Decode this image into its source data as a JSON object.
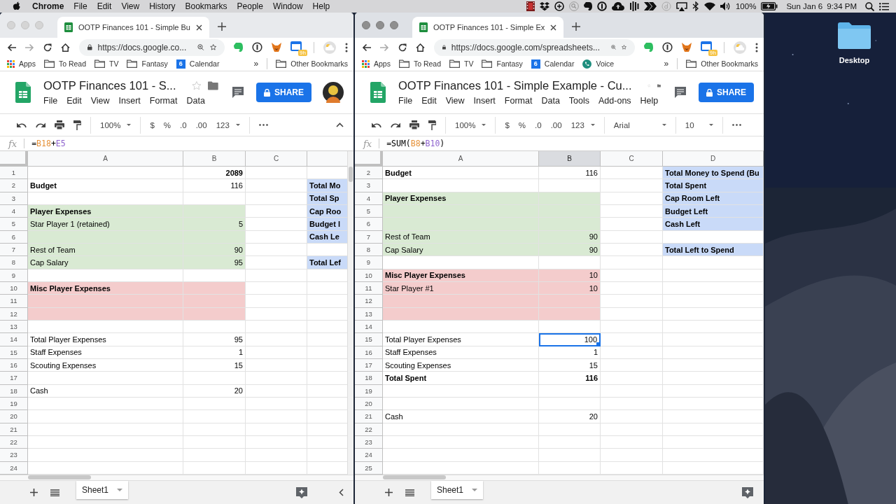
{
  "menubar": {
    "app": "Chrome",
    "menus": [
      "File",
      "Edit",
      "View",
      "History",
      "Bookmarks",
      "People",
      "Window",
      "Help"
    ],
    "battery": "100%",
    "date": "Sun Jan 6",
    "time": "9:34 PM"
  },
  "windows": [
    {
      "active": false,
      "tab_title": "OOTP Finances 101 - Simple Bu",
      "url": "https://docs.google.co...",
      "extension_badge": "9h",
      "bookmarks": [
        {
          "kind": "apps",
          "label": "Apps"
        },
        {
          "kind": "folder",
          "label": "To Read"
        },
        {
          "kind": "folder",
          "label": "TV"
        },
        {
          "kind": "folder",
          "label": "Fantasy"
        },
        {
          "kind": "calendar",
          "label": "Calendar",
          "icon_text": "6"
        }
      ],
      "more_bookmarks": "»",
      "other_bookmarks": "Other Bookmarks",
      "doc_title": "OOTP Finances 101 - S...",
      "menus": [
        "File",
        "Edit",
        "View",
        "Insert",
        "Format",
        "Data"
      ],
      "share": "SHARE",
      "show_avatar": true,
      "zoom": "100%",
      "format_items": [
        "$",
        "%",
        ".0",
        ".00"
      ],
      "number_format": "123",
      "show_collapse": true,
      "formula": {
        "color": "#000000",
        "parts": [
          {
            "text": "="
          },
          {
            "text": "B18",
            "color": "#e69138"
          },
          {
            "text": "+"
          },
          {
            "text": "E5",
            "color": "#8e63ce"
          }
        ]
      },
      "function_label": "fx",
      "columns": [
        {
          "label": "A",
          "selected": false
        },
        {
          "label": "B",
          "selected": false
        },
        {
          "label": "C",
          "selected": false
        },
        {}
      ],
      "rows": [
        {
          "num": "1",
          "cells": [
            {},
            {
              "text": "2089",
              "bold": true
            },
            {},
            {}
          ]
        },
        {
          "num": "2",
          "cells": [
            {
              "text": "Budget",
              "bold": true
            },
            {
              "text": "116"
            },
            {},
            {
              "text": "Total Mo",
              "bold": true,
              "color": "#c9daf8"
            }
          ]
        },
        {
          "num": "3",
          "cells": [
            {},
            {},
            {},
            {
              "text": "Total Sp",
              "bold": true,
              "color": "#c9daf8"
            }
          ]
        },
        {
          "num": "4",
          "cells": [
            {
              "text": "Player Expenses",
              "bold": true,
              "color": "#d9ead3"
            },
            {
              "color": "#d9ead3"
            },
            {},
            {
              "text": "Cap Roo",
              "bold": true,
              "color": "#c9daf8"
            }
          ]
        },
        {
          "num": "5",
          "cells": [
            {
              "text": "Star Player 1 (retained)",
              "color": "#d9ead3"
            },
            {
              "text": "5",
              "color": "#d9ead3"
            },
            {},
            {
              "text": "Budget l",
              "bold": true,
              "color": "#c9daf8"
            }
          ]
        },
        {
          "num": "6",
          "cells": [
            {
              "color": "#d9ead3"
            },
            {
              "color": "#d9ead3"
            },
            {},
            {
              "text": "Cash Le",
              "bold": true,
              "color": "#c9daf8"
            }
          ]
        },
        {
          "num": "7",
          "cells": [
            {
              "text": "Rest of Team",
              "color": "#d9ead3"
            },
            {
              "text": "90",
              "color": "#d9ead3"
            },
            {},
            {}
          ]
        },
        {
          "num": "8",
          "cells": [
            {
              "text": "Cap Salary",
              "color": "#d9ead3"
            },
            {
              "text": "95",
              "color": "#d9ead3"
            },
            {},
            {
              "text": "Total Lef",
              "bold": true,
              "color": "#c9daf8"
            }
          ]
        },
        {
          "num": "9"
        },
        {
          "num": "10",
          "cells": [
            {
              "text": "Misc Player Expenses",
              "bold": true,
              "color": "#f4cccc"
            },
            {
              "color": "#f4cccc"
            },
            {},
            {}
          ]
        },
        {
          "num": "11",
          "cells": [
            {
              "color": "#f4cccc"
            },
            {
              "color": "#f4cccc"
            },
            {},
            {}
          ]
        },
        {
          "num": "12",
          "cells": [
            {
              "color": "#f4cccc"
            },
            {
              "color": "#f4cccc"
            },
            {},
            {}
          ]
        },
        {
          "num": "13"
        },
        {
          "num": "14",
          "cells": [
            {
              "text": "Total Player Expenses"
            },
            {
              "text": "95"
            },
            {},
            {}
          ]
        },
        {
          "num": "15",
          "cells": [
            {
              "text": "Staff Expenses"
            },
            {
              "text": "1"
            },
            {},
            {}
          ]
        },
        {
          "num": "16",
          "cells": [
            {
              "text": "Scouting Expenses"
            },
            {
              "text": "15"
            },
            {},
            {}
          ]
        },
        {
          "num": "17"
        },
        {
          "num": "18",
          "cells": [
            {
              "text": "Cash"
            },
            {
              "text": "20"
            },
            {},
            {}
          ]
        },
        {
          "num": "19"
        },
        {
          "num": "20"
        },
        {
          "num": "21"
        },
        {
          "num": "22"
        },
        {
          "num": "23"
        },
        {
          "num": "24"
        }
      ],
      "sheet_tab": "Sheet1",
      "show_side_toggle": true
    },
    {
      "active": true,
      "tab_title": "OOTP Finances 101 - Simple Ex",
      "url": "https://docs.google.com/spreadsheets...",
      "extension_badge": "9h",
      "bookmarks": [
        {
          "kind": "apps",
          "label": "Apps"
        },
        {
          "kind": "folder",
          "label": "To Read"
        },
        {
          "kind": "folder",
          "label": "TV"
        },
        {
          "kind": "folder",
          "label": "Fantasy"
        },
        {
          "kind": "calendar",
          "label": "Calendar",
          "icon_text": "6"
        },
        {
          "kind": "voice",
          "label": "Voice"
        }
      ],
      "more_bookmarks": "»",
      "other_bookmarks": "Other Bookmarks",
      "doc_title": "OOTP Finances 101 - Simple Example - Cu...",
      "menus": [
        "File",
        "Edit",
        "View",
        "Insert",
        "Format",
        "Data",
        "Tools",
        "Add-ons",
        "Help"
      ],
      "share": "SHARE",
      "zoom": "100%",
      "format_items": [
        "$",
        "%",
        ".0",
        ".00"
      ],
      "number_format": "123",
      "font": "Arial",
      "font_size": "10",
      "formula": {
        "color": "#000000",
        "parts": [
          {
            "text": "=SUM("
          },
          {
            "text": "B8",
            "color": "#e69138"
          },
          {
            "text": "+"
          },
          {
            "text": "B10",
            "color": "#8e63ce"
          },
          {
            "text": ")"
          }
        ]
      },
      "function_label": "fx",
      "columns": [
        {
          "label": "A",
          "selected": false
        },
        {
          "label": "B",
          "selected": true
        },
        {
          "label": "C",
          "selected": false
        },
        {
          "label": "D",
          "selected": false
        }
      ],
      "rows": [
        {
          "num": "2",
          "cells": [
            {
              "text": "Budget",
              "bold": true
            },
            {
              "text": "116"
            },
            {},
            {
              "text": "Total Money to Spend (Bu",
              "bold": true,
              "color": "#c9daf8"
            }
          ]
        },
        {
          "num": "3",
          "cells": [
            {},
            {},
            {},
            {
              "text": "Total Spent",
              "bold": true,
              "color": "#c9daf8"
            }
          ]
        },
        {
          "num": "4",
          "cells": [
            {
              "text": "Player Expenses",
              "bold": true,
              "color": "#d9ead3"
            },
            {
              "color": "#d9ead3"
            },
            {},
            {
              "text": "Cap Room Left",
              "bold": true,
              "color": "#c9daf8"
            }
          ]
        },
        {
          "num": "5",
          "cells": [
            {
              "color": "#d9ead3"
            },
            {
              "color": "#d9ead3"
            },
            {},
            {
              "text": "Budget Left",
              "bold": true,
              "color": "#c9daf8"
            }
          ]
        },
        {
          "num": "6",
          "cells": [
            {
              "color": "#d9ead3"
            },
            {
              "color": "#d9ead3"
            },
            {},
            {
              "text": "Cash Left",
              "bold": true,
              "color": "#c9daf8"
            }
          ]
        },
        {
          "num": "7",
          "cells": [
            {
              "text": "Rest of Team",
              "color": "#d9ead3"
            },
            {
              "text": "90",
              "color": "#d9ead3"
            },
            {},
            {}
          ]
        },
        {
          "num": "8",
          "cells": [
            {
              "text": "Cap Salary",
              "color": "#d9ead3"
            },
            {
              "text": "90",
              "color": "#d9ead3"
            },
            {},
            {
              "text": "Total Left to Spend",
              "bold": true,
              "color": "#c9daf8"
            }
          ]
        },
        {
          "num": "9"
        },
        {
          "num": "10",
          "cells": [
            {
              "text": "Misc Player Expenses",
              "bold": true,
              "color": "#f4cccc"
            },
            {
              "text": "10",
              "color": "#f4cccc"
            },
            {},
            {}
          ]
        },
        {
          "num": "11",
          "cells": [
            {
              "text": "Star Player #1",
              "color": "#f4cccc"
            },
            {
              "text": "10",
              "color": "#f4cccc"
            },
            {},
            {}
          ]
        },
        {
          "num": "12",
          "cells": [
            {
              "color": "#f4cccc"
            },
            {
              "color": "#f4cccc"
            },
            {},
            {}
          ]
        },
        {
          "num": "13",
          "cells": [
            {
              "color": "#f4cccc"
            },
            {
              "color": "#f4cccc"
            },
            {},
            {}
          ]
        },
        {
          "num": "14"
        },
        {
          "num": "15",
          "cells": [
            {
              "text": "Total Player Expenses"
            },
            {
              "text": "100",
              "selected": true
            },
            {},
            {}
          ]
        },
        {
          "num": "16",
          "cells": [
            {
              "text": "Staff Expenses"
            },
            {
              "text": "1"
            },
            {},
            {}
          ]
        },
        {
          "num": "17",
          "cells": [
            {
              "text": "Scouting Expenses"
            },
            {
              "text": "15"
            },
            {},
            {}
          ]
        },
        {
          "num": "18",
          "cells": [
            {
              "text": "Total Spent",
              "bold": true
            },
            {
              "text": "116",
              "bold": true
            },
            {},
            {}
          ]
        },
        {
          "num": "19"
        },
        {
          "num": "20"
        },
        {
          "num": "21",
          "cells": [
            {
              "text": "Cash"
            },
            {
              "text": "20"
            },
            {},
            {}
          ]
        },
        {
          "num": "22"
        },
        {
          "num": "23"
        },
        {
          "num": "24"
        },
        {
          "num": "25"
        }
      ],
      "sheet_tab": "Sheet1"
    }
  ],
  "desktop": {
    "folder_label": "Desktop"
  }
}
